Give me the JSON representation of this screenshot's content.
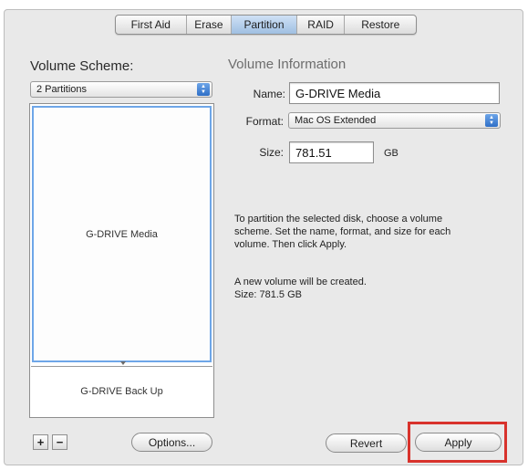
{
  "tabs": [
    {
      "label": "First Aid"
    },
    {
      "label": "Erase"
    },
    {
      "label": "Partition",
      "active": true
    },
    {
      "label": "RAID"
    },
    {
      "label": "Restore"
    }
  ],
  "left": {
    "volume_scheme_label": "Volume Scheme:",
    "scheme_value": "2 Partitions",
    "partitions": [
      {
        "name": "G-DRIVE Media",
        "selected": true
      },
      {
        "name": "G-DRIVE Back Up",
        "selected": false
      }
    ],
    "add_label": "+",
    "remove_label": "−",
    "options_label": "Options..."
  },
  "right": {
    "volume_info_label": "Volume Information",
    "name_label": "Name:",
    "name_value": "G-DRIVE Media",
    "format_label": "Format:",
    "format_value": "Mac OS Extended",
    "size_label": "Size:",
    "size_value": "781.51",
    "size_unit": "GB",
    "help_text": [
      "To partition the selected disk, choose a volume",
      "scheme. Set the name, format, and size for each",
      "volume. Then click Apply."
    ],
    "status_text": [
      "A new volume will be created.",
      "Size: 781.5 GB"
    ]
  },
  "buttons": {
    "revert_label": "Revert",
    "apply_label": "Apply"
  },
  "colors": {
    "accent_blue": "#6ea6e8",
    "highlight_red": "#d8322c",
    "panel_bg": "#e9e9e9"
  }
}
